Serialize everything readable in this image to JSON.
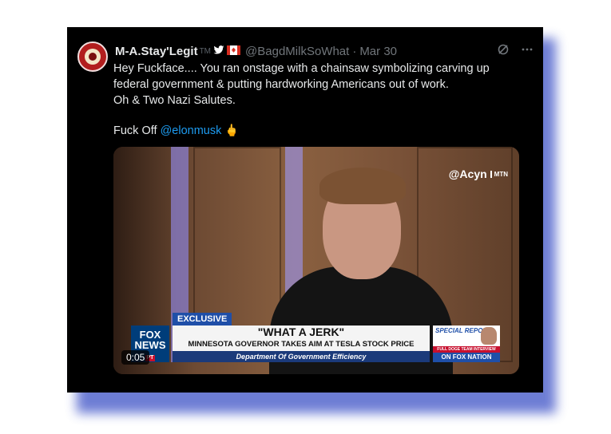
{
  "tweet": {
    "author_name": "M-A.Stay'Legit",
    "author_tm": "TM",
    "bird_icon": "bird-icon",
    "flag_icon": "canada-flag-icon",
    "handle": "@BagdMilkSoWhat",
    "separator": "·",
    "date": "Mar 30",
    "grok_icon": "grok-icon",
    "more_icon": "more-icon",
    "text_line1": "Hey Fuckface.... You ran onstage with a chainsaw symbolizing carving up",
    "text_line2": "federal government & putting hardworking Americans out of work.",
    "text_line3": "Oh & Two Nazi Salutes.",
    "text_line5_prefix": "Fuck Off ",
    "mention": "@elonmusk",
    "emoji": "🖕"
  },
  "media": {
    "watermark": "@Acyn",
    "watermark_mtn": "MTN",
    "timestamp": "0:05",
    "fox": {
      "logo_line1": "FOX",
      "logo_line2": "NEWS",
      "logo_badge": "PT",
      "exclusive": "EXCLUSIVE",
      "headline": "\"WHAT A JERK\"",
      "subline": "MINNESOTA GOVERNOR TAKES AIM AT TESLA STOCK PRICE",
      "ticker": "Department Of Government Efficiency",
      "special_report": "SPECIAL REPORT",
      "interview": "FULL DOGE TEAM INTERVIEW",
      "nation": "ON FOX NATION"
    }
  },
  "colors": {
    "mention": "#1d9bf0",
    "frame_shadow": "#5e6fd0",
    "fox_blue": "#1f4fa8",
    "fox_red": "#c8102e"
  }
}
